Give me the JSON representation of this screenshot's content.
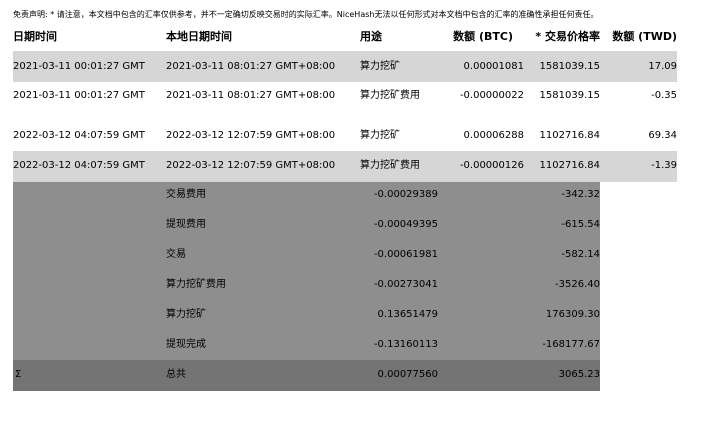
{
  "disclaimer": "免责声明: * 请注意，本文档中包含的汇率仅供参考，并不一定确切反映交易时的实际汇率。NiceHash无法以任何形式对本文档中包含的汇率的准确性承担任何责任。",
  "columns": {
    "date": "日期时间",
    "local_date": "本地日期时间",
    "purpose": "用途",
    "amount_btc": "数额 (BTC)",
    "rate": "* 交易价格率",
    "amount_twd": "数额 (TWD)"
  },
  "rows": [
    {
      "date": "2021-03-11 00:01:27 GMT",
      "local_date": "2021-03-11 08:01:27 GMT+08:00",
      "purpose": "算力挖矿",
      "btc": "0.00001081",
      "rate": "1581039.15",
      "twd": "17.09"
    },
    {
      "date": "2021-03-11 00:01:27 GMT",
      "local_date": "2021-03-11 08:01:27 GMT+08:00",
      "purpose": "算力挖矿费用",
      "btc": "-0.00000022",
      "rate": "1581039.15",
      "twd": "-0.35"
    },
    {
      "date": "2022-03-12 04:07:59 GMT",
      "local_date": "2022-03-12 12:07:59 GMT+08:00",
      "purpose": "算力挖矿",
      "btc": "0.00006288",
      "rate": "1102716.84",
      "twd": "69.34"
    },
    {
      "date": "2022-03-12 04:07:59 GMT",
      "local_date": "2022-03-12 12:07:59 GMT+08:00",
      "purpose": "算力挖矿费用",
      "btc": "-0.00000126",
      "rate": "1102716.84",
      "twd": "-1.39"
    }
  ],
  "summary": [
    {
      "label": "交易费用",
      "btc": "-0.00029389",
      "twd": "-342.32"
    },
    {
      "label": "提现费用",
      "btc": "-0.00049395",
      "twd": "-615.54"
    },
    {
      "label": "交易",
      "btc": "-0.00061981",
      "twd": "-582.14"
    },
    {
      "label": "算力挖矿费用",
      "btc": "-0.00273041",
      "twd": "-3526.40"
    },
    {
      "label": "算力挖矿",
      "btc": "0.13651479",
      "twd": "176309.30"
    },
    {
      "label": "提现完成",
      "btc": "-0.13160113",
      "twd": "-168177.67"
    }
  ],
  "total": {
    "symbol": "Σ",
    "label": "总共",
    "btc": "0.00077560",
    "twd": "3065.23"
  }
}
